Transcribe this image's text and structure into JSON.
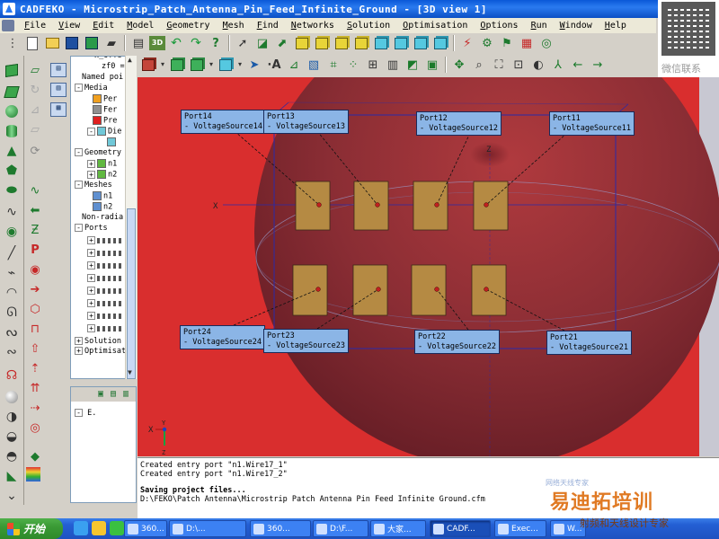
{
  "window": {
    "title": "CADFEKO - Microstrip_Patch_Antenna_Pin_Feed_Infinite_Ground - [3D view 1]"
  },
  "watermark": {
    "wechat_label": "微信联系",
    "brand": "易迪拓培训",
    "tagline": "射频和天线设计专家",
    "faint": "网络天线专家"
  },
  "menubar": {
    "items": [
      "File",
      "View",
      "Edit",
      "Model",
      "Geometry",
      "Mesh",
      "Find",
      "Networks",
      "Solution",
      "Optimisation",
      "Options",
      "Run",
      "Window",
      "Help"
    ]
  },
  "tree": {
    "lines": [
      {
        "text": "x_offs",
        "indent": 26,
        "icon": ""
      },
      {
        "text": "zf0 =",
        "indent": 34,
        "icon": ""
      },
      {
        "text": "Named poi",
        "indent": 12,
        "icon": ""
      },
      {
        "text": "Media",
        "indent": 4,
        "expander": "-",
        "icon": ""
      },
      {
        "text": "Per",
        "indent": 24,
        "icon": "#f0a020"
      },
      {
        "text": "Fer",
        "indent": 24,
        "icon": "#909090"
      },
      {
        "text": "Pre",
        "indent": 24,
        "icon": "#e02020"
      },
      {
        "text": "Die",
        "indent": 18,
        "expander": "-",
        "icon": "#70c8d8"
      },
      {
        "text": "",
        "indent": 40,
        "icon": "#70c8d8"
      },
      {
        "text": "Geometry",
        "indent": 4,
        "expander": "-",
        "icon": ""
      },
      {
        "text": "n1",
        "indent": 18,
        "expander": "+",
        "icon": "#60b840"
      },
      {
        "text": "n2",
        "indent": 18,
        "expander": "+",
        "icon": "#60b840"
      },
      {
        "text": "Meshes",
        "indent": 4,
        "expander": "-",
        "icon": ""
      },
      {
        "text": "n1",
        "indent": 24,
        "icon": "#6090d0"
      },
      {
        "text": "n2",
        "indent": 24,
        "icon": "#6090d0"
      },
      {
        "text": "Non-radia",
        "indent": 12,
        "icon": ""
      },
      {
        "text": "Ports",
        "indent": 4,
        "expander": "-",
        "icon": ""
      }
    ],
    "port_rows": 8,
    "tail": [
      {
        "text": "Solution",
        "expander": "+"
      },
      {
        "text": "Optimisat",
        "expander": "+"
      }
    ]
  },
  "lower_panel": {
    "node": "E."
  },
  "viewport": {
    "axes": {
      "x_label": "X",
      "z_label": "Z"
    },
    "triad": {
      "x": "X",
      "y": "Y",
      "z": "Z"
    },
    "colors": {
      "ground": "#d92e2e",
      "sphere": "#8a2d34",
      "patch": "#b58a43",
      "port_label": "#8bb5e6",
      "outline": "#2a2aa8"
    },
    "ports": [
      {
        "name": "Port14",
        "source": "- VoltageSource14"
      },
      {
        "name": "Port13",
        "source": "- VoltageSource13"
      },
      {
        "name": "Port12",
        "source": "- VoltageSource12"
      },
      {
        "name": "Port11",
        "source": "- VoltageSource11"
      },
      {
        "name": "Port24",
        "source": "- VoltageSource24"
      },
      {
        "name": "Port23",
        "source": "- VoltageSource23"
      },
      {
        "name": "Port22",
        "source": "- VoltageSource22"
      },
      {
        "name": "Port21",
        "source": "- VoltageSource21"
      }
    ]
  },
  "messages": {
    "lines": [
      "Created entry port \"n1.Wire17_1\"",
      "Created entry port \"n1.Wire17_2\""
    ],
    "saving": "Saving project files...",
    "path": "D:\\FEKO\\Patch Antenna\\Microstrip Patch Antenna Pin Feed Infinite Ground.cfm"
  },
  "taskbar": {
    "start_label": "开始",
    "tasks": [
      {
        "label": "360...",
        "active": false
      },
      {
        "label": "D:\\...",
        "active": false
      },
      {
        "label": "360...",
        "active": false
      },
      {
        "label": "D:\\F...",
        "active": false
      },
      {
        "label": "大家...",
        "active": false
      },
      {
        "label": "CADF...",
        "active": true
      },
      {
        "label": "Exec...",
        "active": false
      },
      {
        "label": "W...",
        "active": false
      }
    ]
  }
}
